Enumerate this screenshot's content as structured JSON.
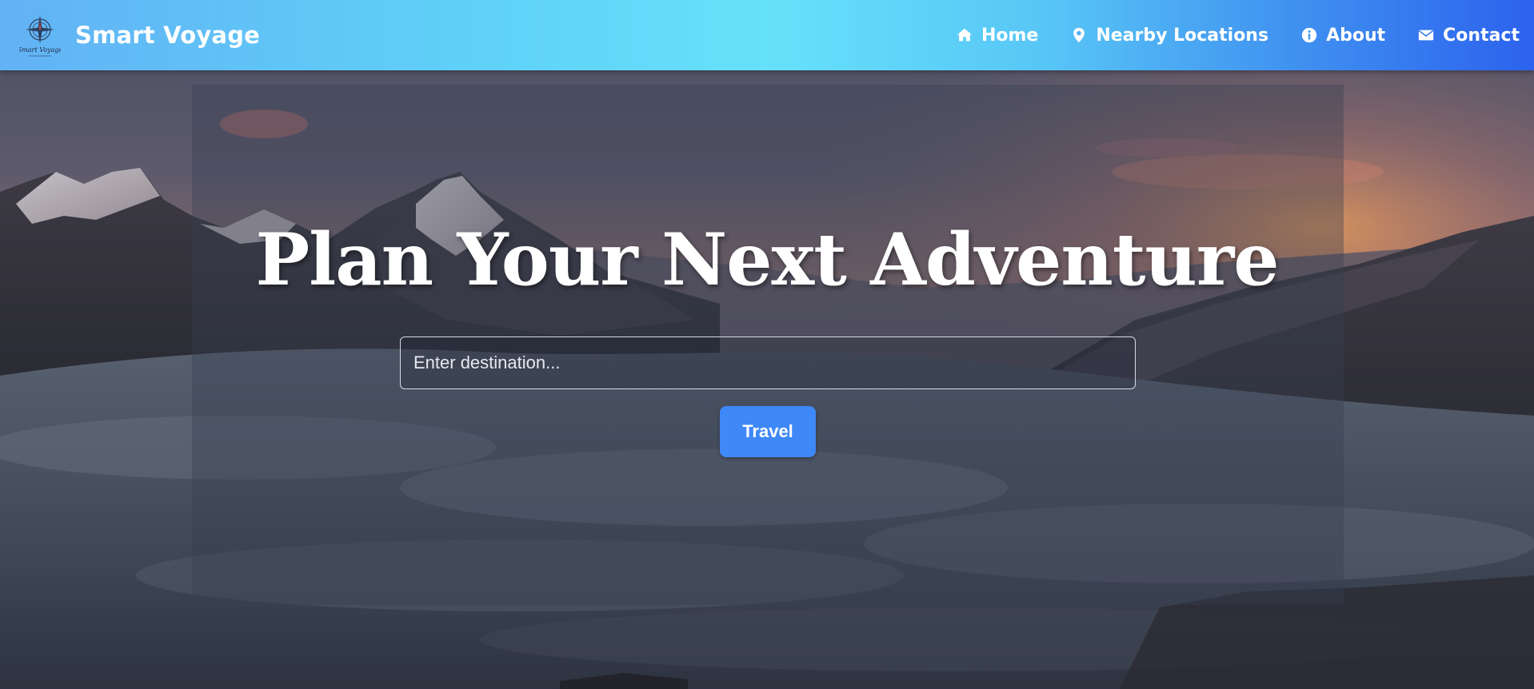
{
  "header": {
    "brand_name": "Smart Voyage",
    "logo": {
      "icon": "compass-rose-icon",
      "text": "Smart Voyage"
    },
    "nav": [
      {
        "label": "Home",
        "icon": "home-icon"
      },
      {
        "label": "Nearby Locations",
        "icon": "map-pin-icon"
      },
      {
        "label": "About",
        "icon": "info-circle-icon"
      },
      {
        "label": "Contact",
        "icon": "envelope-icon"
      }
    ],
    "gradient_colors": [
      "#62b2f5",
      "#66e1fa",
      "#2c62ee"
    ]
  },
  "hero": {
    "title": "Plan Your Next Adventure",
    "search": {
      "placeholder": "Enter destination...",
      "value": ""
    },
    "button_label": "Travel",
    "button_color": "#3f88f7",
    "background": "mountains-above-clouds-sunset-photo"
  }
}
